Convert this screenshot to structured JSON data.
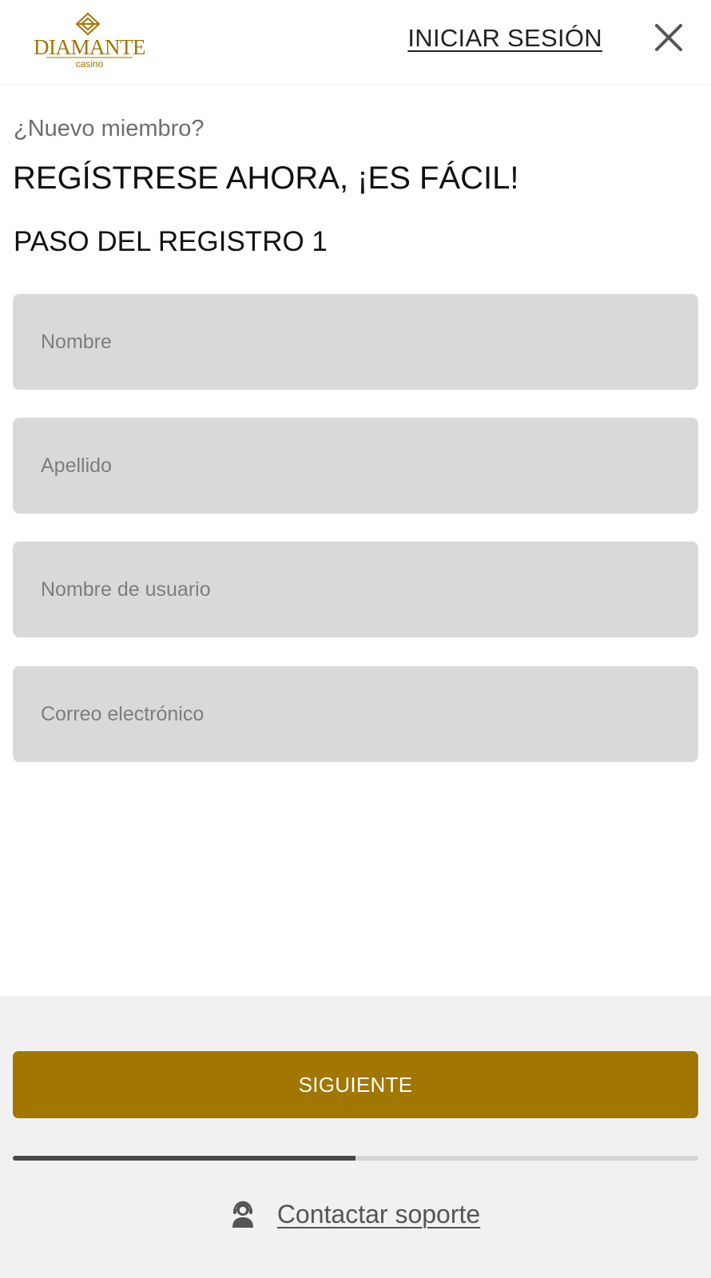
{
  "colors": {
    "brand_gold": "#a17601",
    "field_bg": "#d9d9d9",
    "footer_bg": "#f1f1f1",
    "progress_fill": "#474747",
    "progress_track": "#d4d4d4"
  },
  "header": {
    "logo": {
      "wordmark": "DIAMANTE",
      "subtext": "casino",
      "icon": "diamond-logo-icon"
    },
    "login_label": "INICIAR SESIÓN",
    "close_icon": "close-icon"
  },
  "registration": {
    "kicker": "¿Nuevo miembro?",
    "headline": "REGÍSTRESE AHORA, ¡ES FÁCIL!",
    "step_label": "PASO DEL REGISTRO 1",
    "fields": [
      {
        "placeholder": "Nombre",
        "value": ""
      },
      {
        "placeholder": "Apellido",
        "value": ""
      },
      {
        "placeholder": "Nombre de usuario",
        "value": ""
      },
      {
        "placeholder": "Correo electrónico",
        "value": ""
      }
    ]
  },
  "footer": {
    "next_label": "SIGUIENTE",
    "progress_fraction": 0.5,
    "support_icon": "support-agent-icon",
    "support_label": "Contactar soporte"
  }
}
